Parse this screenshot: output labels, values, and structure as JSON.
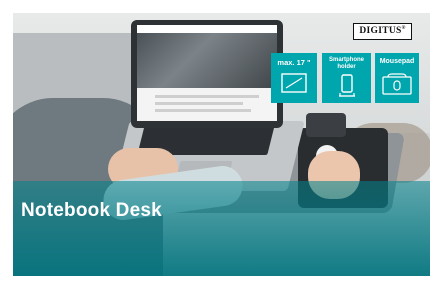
{
  "brand": {
    "logo_text": "DIGITUS",
    "registered_mark": "®"
  },
  "headline": "Notebook Desk",
  "features": [
    {
      "label": "max. 17 \"",
      "icon": "laptop-screen-icon"
    },
    {
      "label_line1": "Smartphone",
      "label_line2": "holder",
      "icon": "smartphone-icon"
    },
    {
      "label": "Mousepad",
      "icon": "mousepad-icon"
    }
  ],
  "colors": {
    "tile_teal": "#00a6ad",
    "banner_teal": "#00737d",
    "title_text": "#ffffff"
  }
}
